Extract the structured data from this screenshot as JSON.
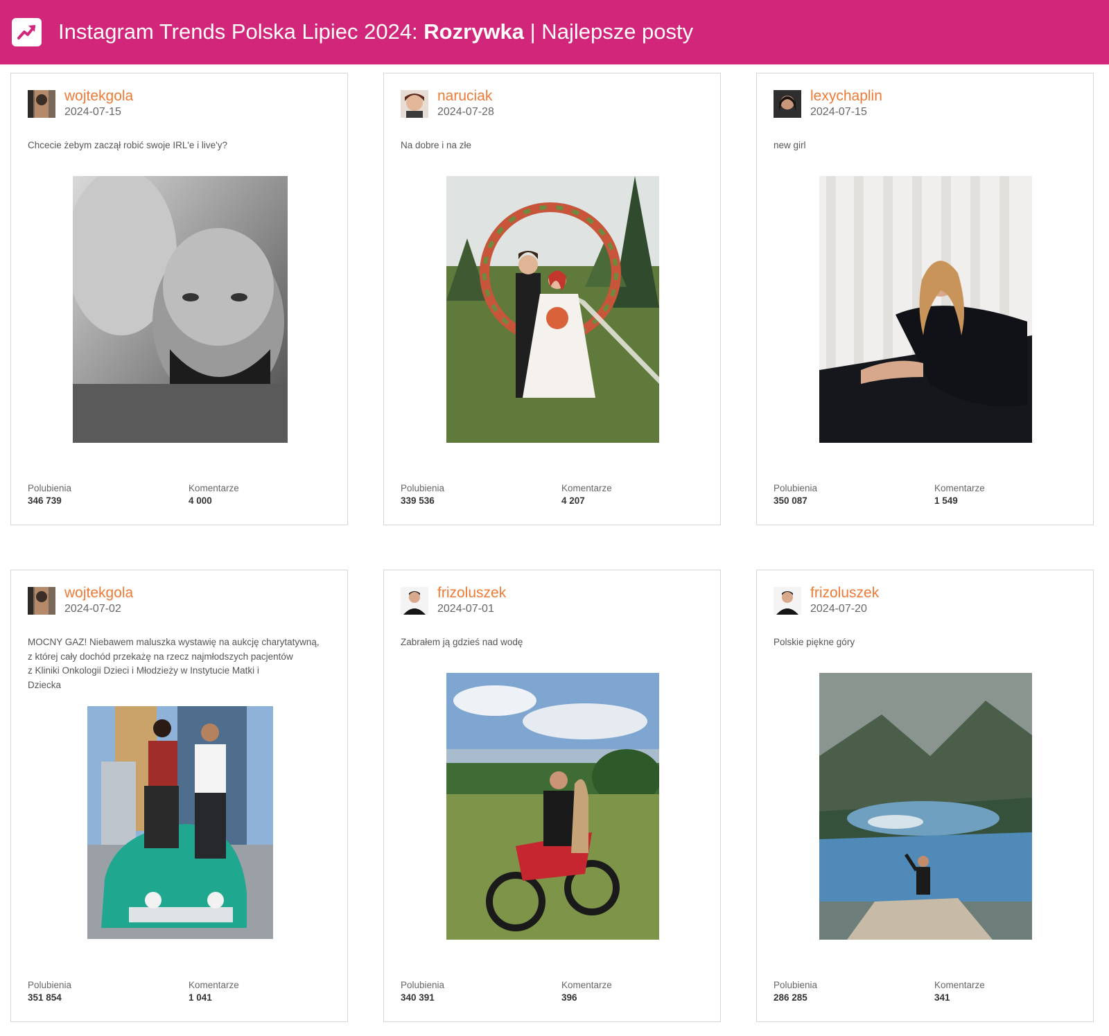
{
  "header": {
    "logo_icon": "trending-up-icon",
    "title_prefix": "Instagram Trends Polska Lipiec 2024: ",
    "title_category": "Rozrywka",
    "title_suffix": " | Najlepsze posty",
    "color": "#d1267a"
  },
  "labels": {
    "likes": "Polubienia",
    "comments": "Komentarze"
  },
  "posts": [
    {
      "username": "wojtekgola",
      "date": "2024-07-15",
      "caption": [
        "Chcecie żebym zaczął robić swoje IRL'e i live'y?"
      ],
      "likes": "346 739",
      "comments": "4 000"
    },
    {
      "username": "naruciak",
      "date": "2024-07-28",
      "caption": [
        "Na dobre i na złe"
      ],
      "likes": "339 536",
      "comments": "4 207"
    },
    {
      "username": "lexychaplin",
      "date": "2024-07-15",
      "caption": [
        "new girl"
      ],
      "likes": "350 087",
      "comments": "1 549"
    },
    {
      "username": "wojtekgola",
      "date": "2024-07-02",
      "caption": [
        "MOCNY GAZ! Niebawem maluszka wystawię na aukcję charytatywną,",
        "z której cały dochód przekażę na rzecz najmłodszych pacjentów",
        "z Kliniki Onkologii Dzieci i Młodzieży w Instytucie Matki i",
        "Dziecka"
      ],
      "likes": "351 854",
      "comments": "1 041"
    },
    {
      "username": "frizoluszek",
      "date": "2024-07-01",
      "caption": [
        "Zabrałem ją gdzieś nad wodę"
      ],
      "likes": "340 391",
      "comments": "396"
    },
    {
      "username": "frizoluszek",
      "date": "2024-07-20",
      "caption": [
        "Polskie piękne góry"
      ],
      "likes": "286 285",
      "comments": "341"
    }
  ]
}
